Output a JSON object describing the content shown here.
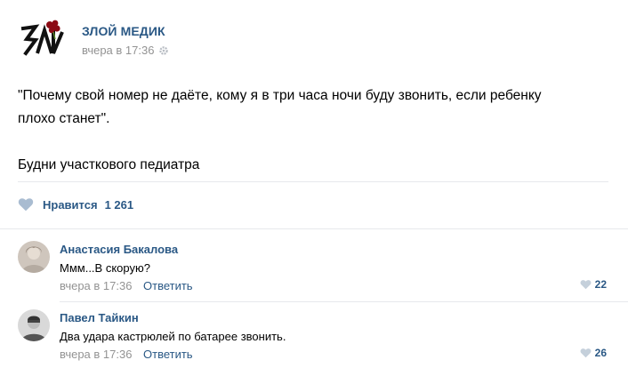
{
  "post": {
    "author": "ЗЛОЙ МЕДИК",
    "time": "вчера в 17:36",
    "text_line1": "\"Почему свой номер не даёте, кому я в три часа ночи буду звонить, если ребенку",
    "text_line2": "плохо станет\".",
    "text_line3": "Будни участкового педиатра",
    "like_label": "Нравится",
    "like_count": "1 261",
    "logo_letters": "ЗЛИ"
  },
  "comments": [
    {
      "author": "Анастасия Бакалова",
      "text": "Ммм...В скорую?",
      "time": "вчера в 17:36",
      "reply_label": "Ответить",
      "likes": "22"
    },
    {
      "author": "Павел Тайкин",
      "text": "Два удара кастрюлей по батарее звонить.",
      "time": "вчера в 17:36",
      "reply_label": "Ответить",
      "likes": "26"
    }
  ],
  "colors": {
    "link": "#2a5885",
    "meta": "#939393",
    "divider": "#e7e8ec",
    "heart": "#a9bcd1",
    "logo_red": "#8b0a14"
  },
  "icons": {
    "logo": "zli-logo",
    "settings": "gear-icon",
    "like": "heart-icon"
  }
}
